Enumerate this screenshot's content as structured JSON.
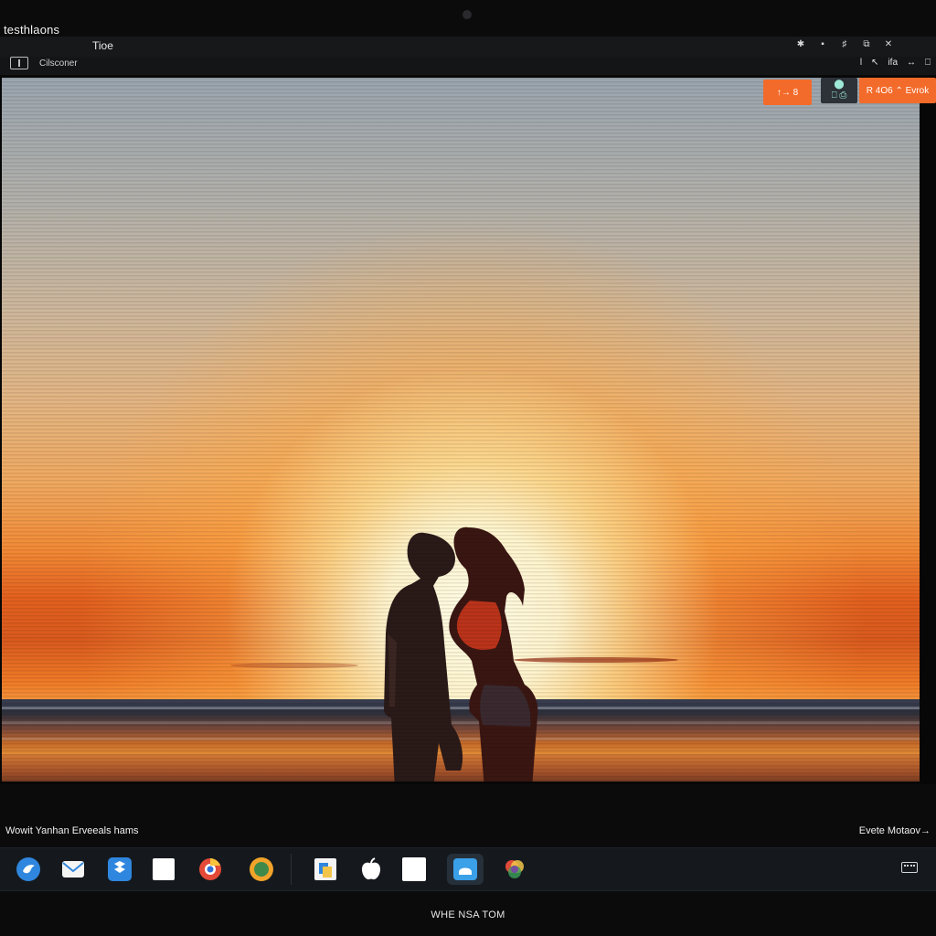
{
  "window": {
    "top_label": "testhlaons",
    "title": "Tioe",
    "controls": [
      "✱",
      "▪",
      "♯",
      "⧉",
      "✕"
    ]
  },
  "toolbar": {
    "label": "Cilsconer",
    "right_items": [
      "l",
      "↖",
      "ifa",
      "↔",
      "⎕"
    ]
  },
  "overlay": {
    "chip_a": "↑→ 8",
    "chip_b_top": "⬤",
    "chip_b_bottom": "⎕ ⎙",
    "chip_c": "R 4O6 ⌃ Evrok"
  },
  "info": {
    "left": "Wowit Yanhan Erveeals hams",
    "right": "Evete Motaov→"
  },
  "dock": {
    "items": [
      {
        "name": "bird-icon",
        "color": "#2f86de"
      },
      {
        "name": "mail-icon",
        "color": "#f4f4f4"
      },
      {
        "name": "dropbox-icon",
        "color": "#2f86de"
      },
      {
        "name": "blank-doc-icon",
        "color": "#ffffff"
      },
      {
        "name": "chrome-icon",
        "color": "#e34a37"
      },
      {
        "name": "globe-icon",
        "color": "#f2a32a"
      },
      {
        "name": "finder-icon",
        "color": "#f2c54a"
      },
      {
        "name": "apple-icon",
        "color": "#ffffff"
      },
      {
        "name": "white-square-icon",
        "color": "#ffffff"
      },
      {
        "name": "cloud-app-icon",
        "color": "#3aa0e8"
      },
      {
        "name": "color-wheel-icon",
        "color": "#e04a3a"
      }
    ]
  },
  "footer": {
    "caption": "WHE NSA TOM"
  }
}
